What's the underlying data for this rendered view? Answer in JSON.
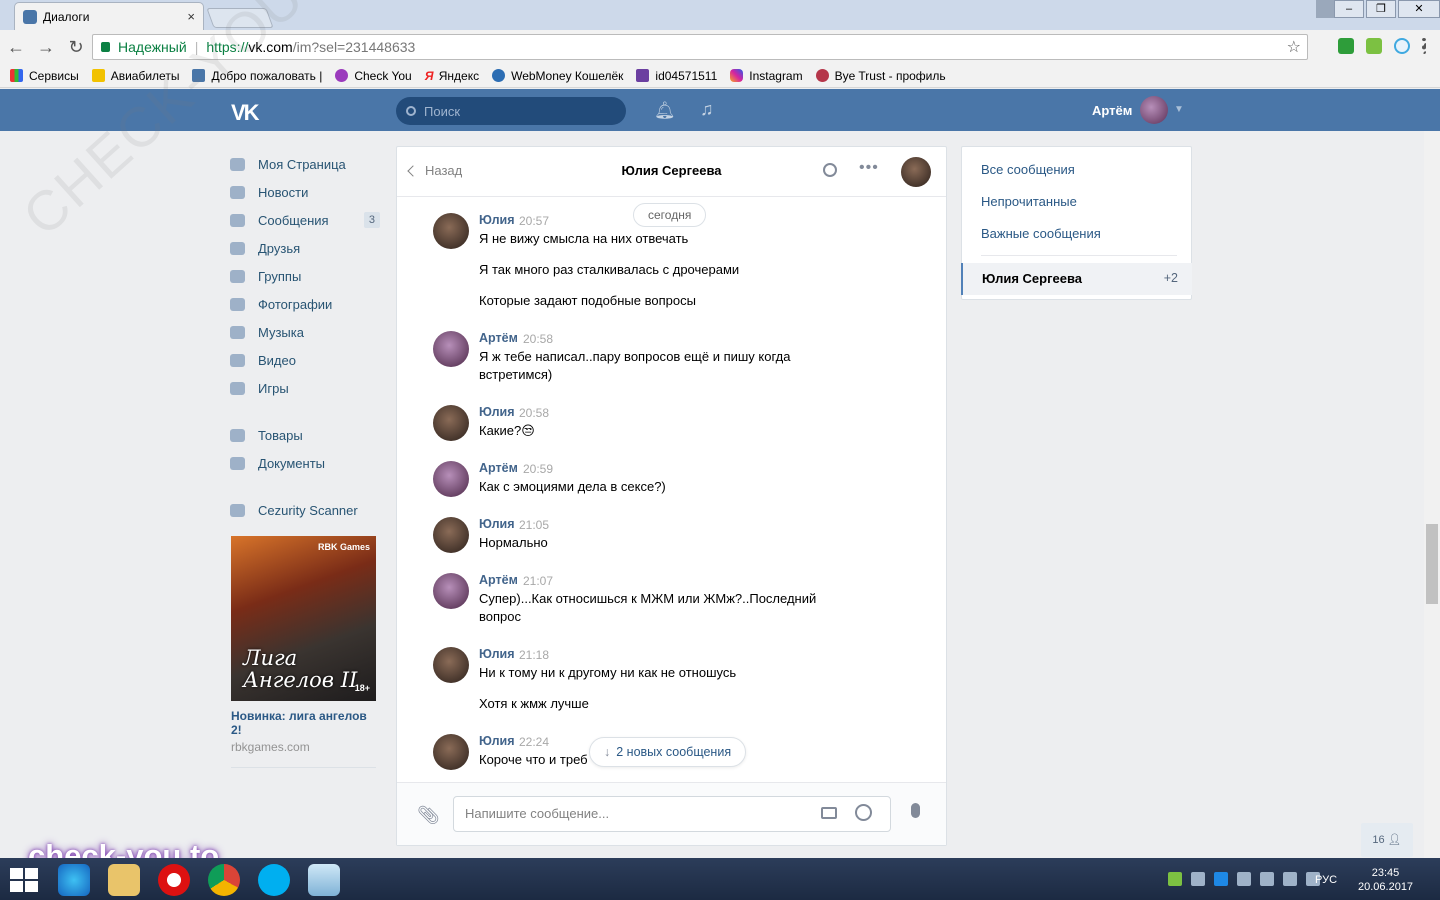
{
  "browser": {
    "tab_title": "Диалоги",
    "tab_close": "×",
    "secure_label": "Надежный",
    "url_proto": "https://",
    "url_host": "vk.com",
    "url_path": "/im?sel=231448633",
    "bookmarks": [
      "Сервисы",
      "Авиабилеты",
      "Добро пожаловать |",
      "Check You",
      "Яндекс",
      "WebMoney Кошелёк",
      "id04571511",
      "Instagram",
      "Bye Trust - профиль"
    ]
  },
  "vk_header": {
    "logo": "VK",
    "search_placeholder": "Поиск",
    "user_name": "Артём"
  },
  "left_nav": {
    "items": [
      {
        "label": "Моя Страница",
        "badge": ""
      },
      {
        "label": "Новости",
        "badge": ""
      },
      {
        "label": "Сообщения",
        "badge": "3"
      },
      {
        "label": "Друзья",
        "badge": ""
      },
      {
        "label": "Группы",
        "badge": ""
      },
      {
        "label": "Фотографии",
        "badge": ""
      },
      {
        "label": "Музыка",
        "badge": ""
      },
      {
        "label": "Видео",
        "badge": ""
      },
      {
        "label": "Игры",
        "badge": ""
      }
    ],
    "items2": [
      "Товары",
      "Документы"
    ],
    "items3": [
      "Cezurity Scanner"
    ]
  },
  "ad": {
    "image_brand": "RBK Games",
    "image_title": "Лига Ангелов II",
    "age": "18+",
    "title": "Новинка: лига ангелов 2!",
    "site": "rbkgames.com"
  },
  "chat": {
    "back_label": "Назад",
    "peer_name": "Юлия Сергеева",
    "date_divider": "сегодня",
    "messages": [
      {
        "author": "Юлия",
        "time": "20:57",
        "lines": [
          "Я не вижу смысла на них отвечать",
          "Я так много раз сталкивалась с дрочерами",
          "Которые задают подобные вопросы"
        ]
      },
      {
        "author": "Артём",
        "time": "20:58",
        "lines": [
          "Я ж тебе написал..пару вопросов ещё и пишу когда",
          "встретимся)"
        ]
      },
      {
        "author": "Юлия",
        "time": "20:58",
        "lines": [
          "Какие?😒"
        ]
      },
      {
        "author": "Артём",
        "time": "20:59",
        "lines": [
          "Как с эмоциями дела в сексе?)"
        ]
      },
      {
        "author": "Юлия",
        "time": "21:05",
        "lines": [
          "Нормально"
        ]
      },
      {
        "author": "Артём",
        "time": "21:07",
        "lines": [
          "Супер)...Как относишься к МЖМ или ЖМж?..Последний",
          "вопрос"
        ]
      },
      {
        "author": "Юлия",
        "time": "21:18",
        "lines": [
          "Ни к тому ни к другому ни как не отношусь",
          "Хотя к жмж лучше"
        ]
      },
      {
        "author": "Юлия",
        "time": "22:24",
        "lines": [
          "Короче что и треб"
        ]
      }
    ],
    "new_messages_label": "2 новых сообщения",
    "composer_placeholder": "Напишите сообщение..."
  },
  "right_panel": {
    "links": [
      "Все сообщения",
      "Непрочитанные",
      "Важные сообщения"
    ],
    "active_dialog": "Юлия Сергеева",
    "active_count": "+2"
  },
  "friends_online": "16",
  "watermark": "check-you.to",
  "taskbar": {
    "lang": "РУС",
    "time": "23:45",
    "date": "20.06.2017"
  },
  "colors": {
    "vk_blue": "#4a76a8",
    "link": "#2a5885",
    "author": "#42648b",
    "page_bg": "#edeef0"
  }
}
